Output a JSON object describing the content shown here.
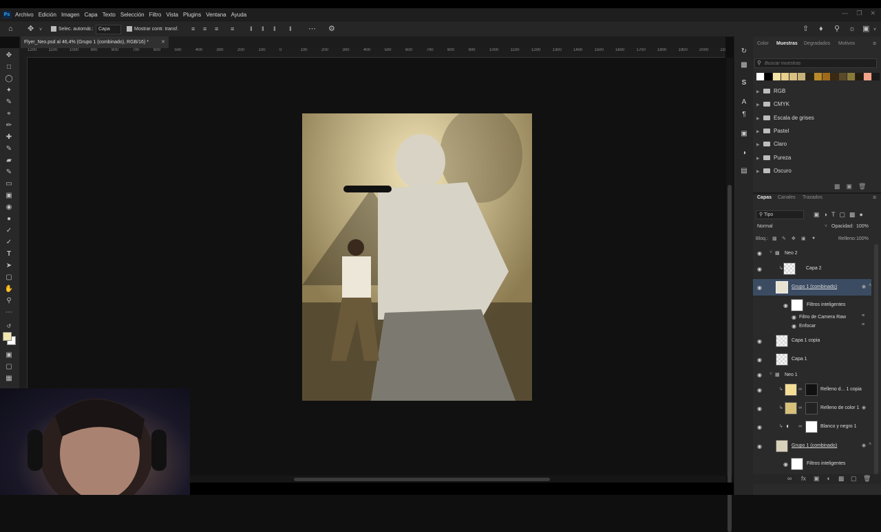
{
  "app": {
    "logo": "Ps"
  },
  "menu": [
    "Archivo",
    "Edición",
    "Imagen",
    "Capa",
    "Texto",
    "Selección",
    "Filtro",
    "Vista",
    "Plugins",
    "Ventana",
    "Ayuda"
  ],
  "options": {
    "autoselect_label": "Selec. automát.:",
    "autoselect_value": "Capa",
    "transform_label": "Mostrar contr. transf."
  },
  "document": {
    "tab_title": "Flyer_Neo.psd al 46,4% (Grupo 1 (combinado), RGB/16) *"
  },
  "ruler_ticks": [
    "1200",
    "1100",
    "1000",
    "900",
    "800",
    "700",
    "600",
    "500",
    "400",
    "300",
    "200",
    "100",
    "0",
    "100",
    "200",
    "300",
    "400",
    "500",
    "600",
    "700",
    "800",
    "900",
    "1000",
    "1100",
    "1200",
    "1300",
    "1400",
    "1500",
    "1600",
    "1700",
    "1800",
    "1900",
    "2000",
    "2100",
    "2200",
    "2300",
    "2400",
    "2500"
  ],
  "swatches": {
    "tabs": [
      "Color",
      "Muestras",
      "Degradados",
      "Motivos"
    ],
    "active_tab": "Muestras",
    "search_placeholder": "Buscar muestras",
    "colors": [
      "#ffffff",
      "#000000",
      "#f5e3a6",
      "#e8cf8c",
      "#d9bf82",
      "#c8b27a",
      "#2a2418",
      "#b88a2a",
      "#a06a1a",
      "#3a2a12",
      "#5a4a2a",
      "#8a7a3a",
      "#241c10",
      "#f4a48a",
      "#1a1a1a"
    ],
    "folders": [
      "RGB",
      "CMYK",
      "Escala de grises",
      "Pastel",
      "Claro",
      "Pureza",
      "Oscuro"
    ]
  },
  "layers_panel": {
    "tabs": [
      "Capas",
      "Canales",
      "Trazados"
    ],
    "active_tab": "Capas",
    "filter": "Tipo",
    "blend_mode": "Normal",
    "opacity_label": "Opacidad:",
    "opacity_value": "100%",
    "lock_label": "Bloq.:",
    "fill_label": "Relleno:",
    "fill_value": "100%",
    "items": [
      {
        "name": "Neo 2",
        "kind": "group"
      },
      {
        "name": "Capa 2",
        "kind": "layer"
      },
      {
        "name": "Grupo 1 (combinado)",
        "kind": "smart",
        "selected": true
      },
      {
        "name": "Filtros inteligentes",
        "kind": "filters"
      },
      {
        "name": "Filtro de Camera Raw",
        "kind": "filter"
      },
      {
        "name": "Enfocar",
        "kind": "filter"
      },
      {
        "name": "Capa 1 copia",
        "kind": "layer"
      },
      {
        "name": "Capa 1",
        "kind": "layer"
      },
      {
        "name": "Neo 1",
        "kind": "group"
      },
      {
        "name": "Relleno d... 1 copia",
        "kind": "fill"
      },
      {
        "name": "Relleno de color 1",
        "kind": "fill"
      },
      {
        "name": "Blanco y negro 1",
        "kind": "adjustment"
      },
      {
        "name": "Grupo 1 (combinado)",
        "kind": "smart"
      },
      {
        "name": "Filtros inteligentes",
        "kind": "filters"
      }
    ]
  },
  "colors": {
    "accent_blue": "#3b4b62",
    "foreground": "#f2e6b0",
    "background": "#ffffff"
  }
}
